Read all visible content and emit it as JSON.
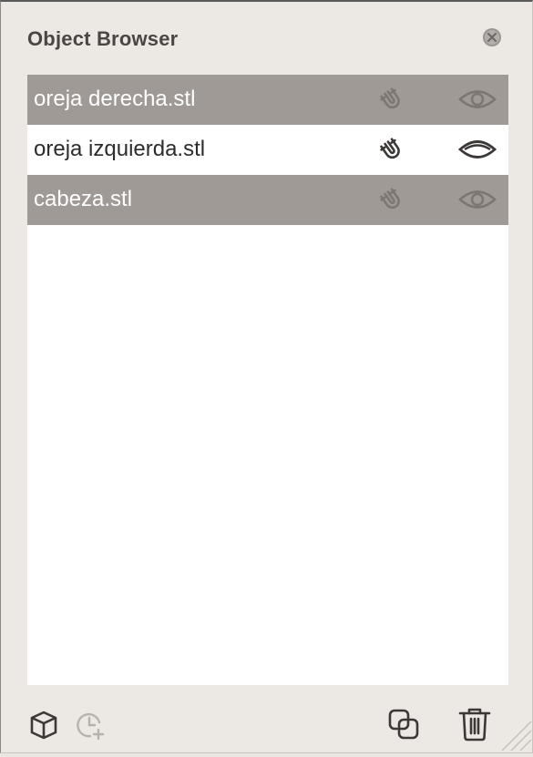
{
  "panel": {
    "title": "Object Browser",
    "close_icon": "close-icon"
  },
  "objects": [
    {
      "name": "oreja derecha.stl",
      "selected": true,
      "magnet_icon": "magnet-icon",
      "visibility_icon": "eye-icon",
      "visible": true
    },
    {
      "name": "oreja izquierda.stl",
      "selected": false,
      "magnet_icon": "magnet-icon",
      "visibility_icon": "eye-icon",
      "visible": true
    },
    {
      "name": "cabeza.stl",
      "selected": true,
      "magnet_icon": "magnet-icon",
      "visibility_icon": "eye-icon",
      "visible": true
    }
  ],
  "toolbar": {
    "left_icons": [
      "cube-icon",
      "clock-plus-icon"
    ],
    "right_icons": [
      "duplicate-icon",
      "trash-icon"
    ]
  },
  "colors": {
    "panel_bg": "#ece8e4",
    "selected_row": "#a09a96",
    "list_bg": "#ffffff",
    "title_text": "#4a4644"
  }
}
